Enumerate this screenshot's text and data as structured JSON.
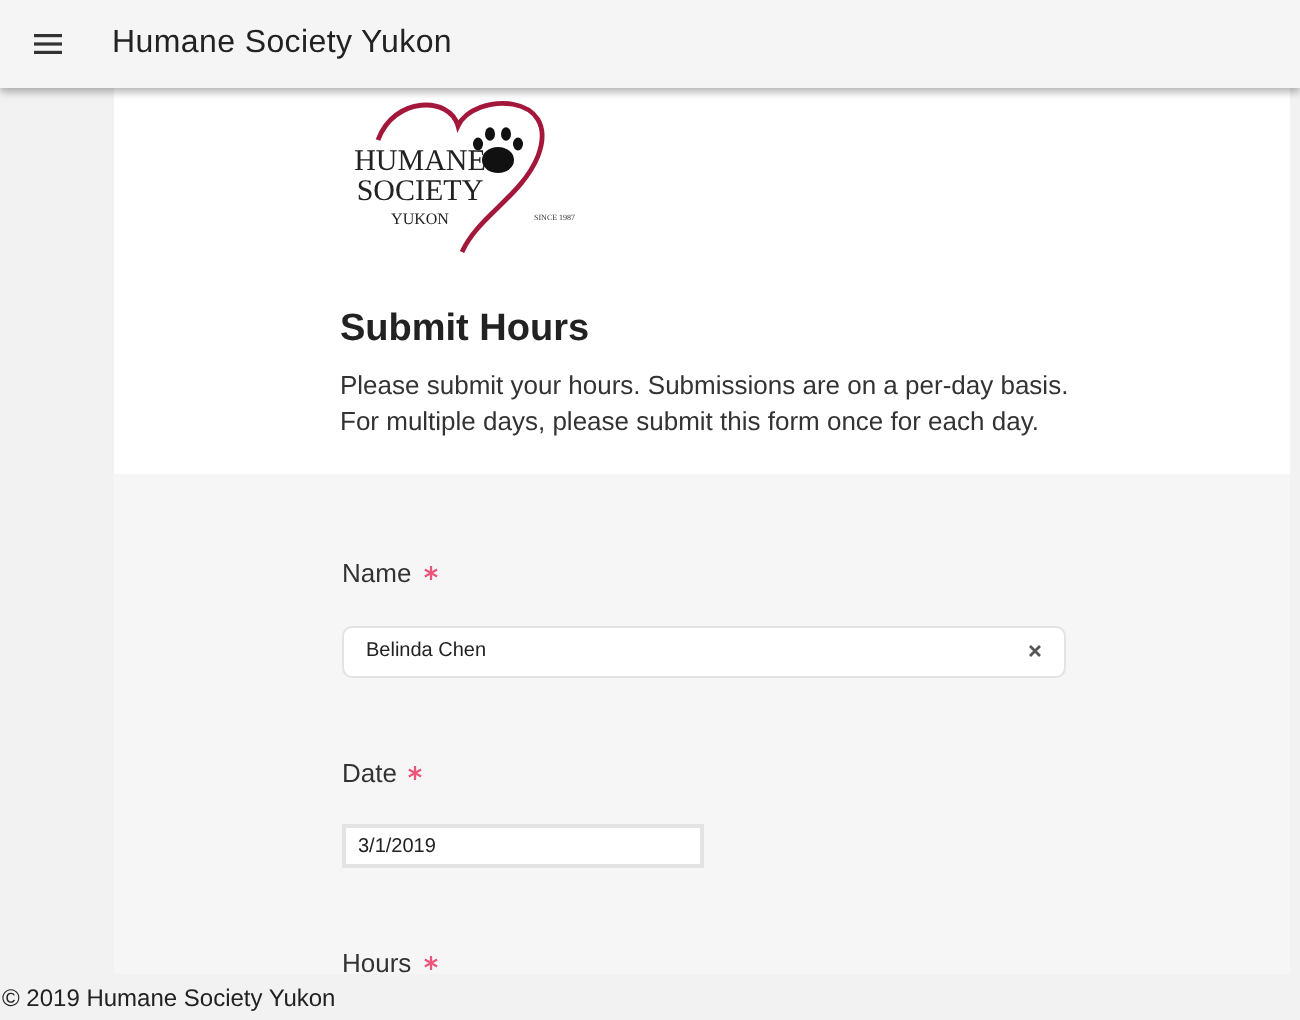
{
  "app_bar": {
    "title": "Humane Society Yukon"
  },
  "logo": {
    "lines": [
      "HUMANE",
      "SOCIETY",
      "YUKON"
    ],
    "since": "SINCE 1987"
  },
  "header": {
    "title": "Submit Hours",
    "description": [
      "Please submit your hours. Submissions are on a per-day basis.",
      "For multiple days, please submit this form once for each day."
    ]
  },
  "fields": [
    {
      "label": "Name",
      "required": true,
      "kind": "text",
      "value": "Belinda Chen",
      "clearable": true
    },
    {
      "label": "Date",
      "required": true,
      "kind": "date",
      "value": "3/1/2019"
    },
    {
      "label": "Hours",
      "required": true
    }
  ],
  "footer": {
    "text": "© 2019 Humane Society Yukon"
  }
}
